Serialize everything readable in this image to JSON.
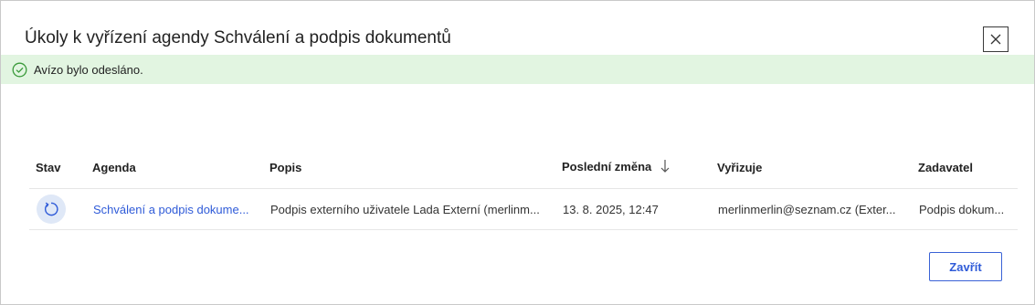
{
  "dialog": {
    "title": "Úkoly k vyřízení agendy Schválení a podpis dokumentů",
    "close_icon": "close-icon"
  },
  "alert": {
    "icon": "check-circle-icon",
    "message": "Avízo bylo odesláno.",
    "color": "#e2f5e1"
  },
  "table": {
    "columns": [
      "Stav",
      "Agenda",
      "Popis",
      "Poslední změna",
      "Vyřizuje",
      "Zadavatel"
    ],
    "sorted_column": "Poslední změna",
    "sort_direction": "descending",
    "sort_icon": "arrow-down-icon",
    "rows": [
      {
        "status_icon": "refresh-icon",
        "agenda": "Schválení a podpis dokume...",
        "popis": "Podpis externího uživatele Lada Externí (merlinm...",
        "posledni_zmena": "13. 8. 2025, 12:47",
        "vyrizuje": "merlinmerlin@seznam.cz (Exter...",
        "zadavatel": "Podpis dokum..."
      }
    ]
  },
  "footer": {
    "close_label": "Zavřít"
  },
  "colors": {
    "accent": "#2f5bd8",
    "success_bg": "#e2f5e1",
    "status_bg": "#dfe8f7"
  }
}
